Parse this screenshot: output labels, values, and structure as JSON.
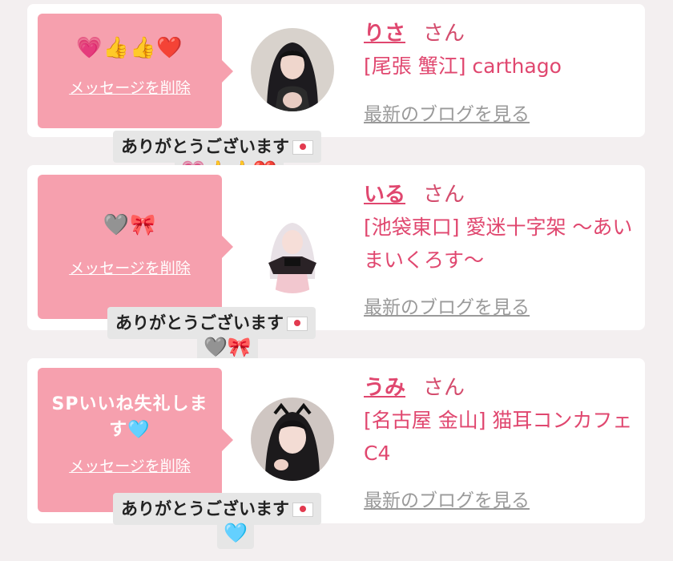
{
  "cards": [
    {
      "message": "💗👍👍❤️",
      "delete_label": "メッセージを削除",
      "name": "りさ",
      "honorific": "さん",
      "shop": "[尾張 蟹江] carthago",
      "blog_link": "最新のブログを見る",
      "thanks": "ありがとうございます",
      "reply": "💗👍👍❤️"
    },
    {
      "message": "🩶🎀",
      "delete_label": "メッセージを削除",
      "name": "いる",
      "honorific": "さん",
      "shop": "[池袋東口] 愛迷十字架 〜あいまいくろす〜",
      "blog_link": "最新のブログを見る",
      "thanks": "ありがとうございます",
      "reply": "🩶🎀"
    },
    {
      "message": "SPいいね失礼します🩵",
      "delete_label": "メッセージを削除",
      "name": "うみ",
      "honorific": "さん",
      "shop": "[名古屋 金山] 猫耳コンカフェ C4",
      "blog_link": "最新のブログを見る",
      "thanks": "ありがとうございます",
      "reply": "🩵"
    }
  ],
  "icons": {
    "envelope": "envelope-icon",
    "avatar": "avatar-photo"
  },
  "colors": {
    "bubble": "#f6a0ae",
    "accent": "#e0476f",
    "thanks_bg": "#e6e6e6"
  }
}
